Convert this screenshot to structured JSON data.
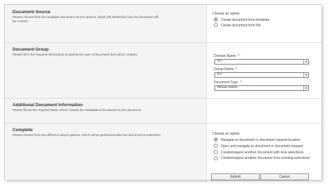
{
  "document_source": {
    "title": "Document Source",
    "description": "Please choose from the available document source options, which will determine how the document will be created.",
    "option_header": "Choose an option",
    "options": [
      {
        "label": "Create document from template",
        "selected": true
      },
      {
        "label": "Create document from file",
        "selected": false
      }
    ]
  },
  "document_group": {
    "title": "Document Group",
    "description": "Please fill in the required information to specify the type of document that will be created.",
    "domain_name": {
      "label": "Domain Name",
      "required_mark": "*",
      "value": "NA"
    },
    "group_name": {
      "label": "Group Name",
      "required_mark": "*",
      "value": "NA"
    },
    "document_type": {
      "label": "Document Type",
      "required_mark": "*",
      "value": "Please select..."
    }
  },
  "additional_info": {
    "title": "Additional Document Information",
    "description": "Please fill out the required fields, which contain the metadata to be placed on the document."
  },
  "complete": {
    "title": "Complete",
    "description": "Please choose from the different submit options, which will be performed after the document is submitted.",
    "option_header": "Choose an option",
    "options": [
      {
        "label": "Navigate to document or document request location",
        "selected": true
      },
      {
        "label": "Open and navigate to document or document request",
        "selected": false
      },
      {
        "label": "Create/request another document with new selections",
        "selected": false
      },
      {
        "label": "Create/request another document from existing selections",
        "selected": false
      }
    ]
  },
  "buttons": {
    "submit": "Submit",
    "cancel": "Cancel"
  }
}
